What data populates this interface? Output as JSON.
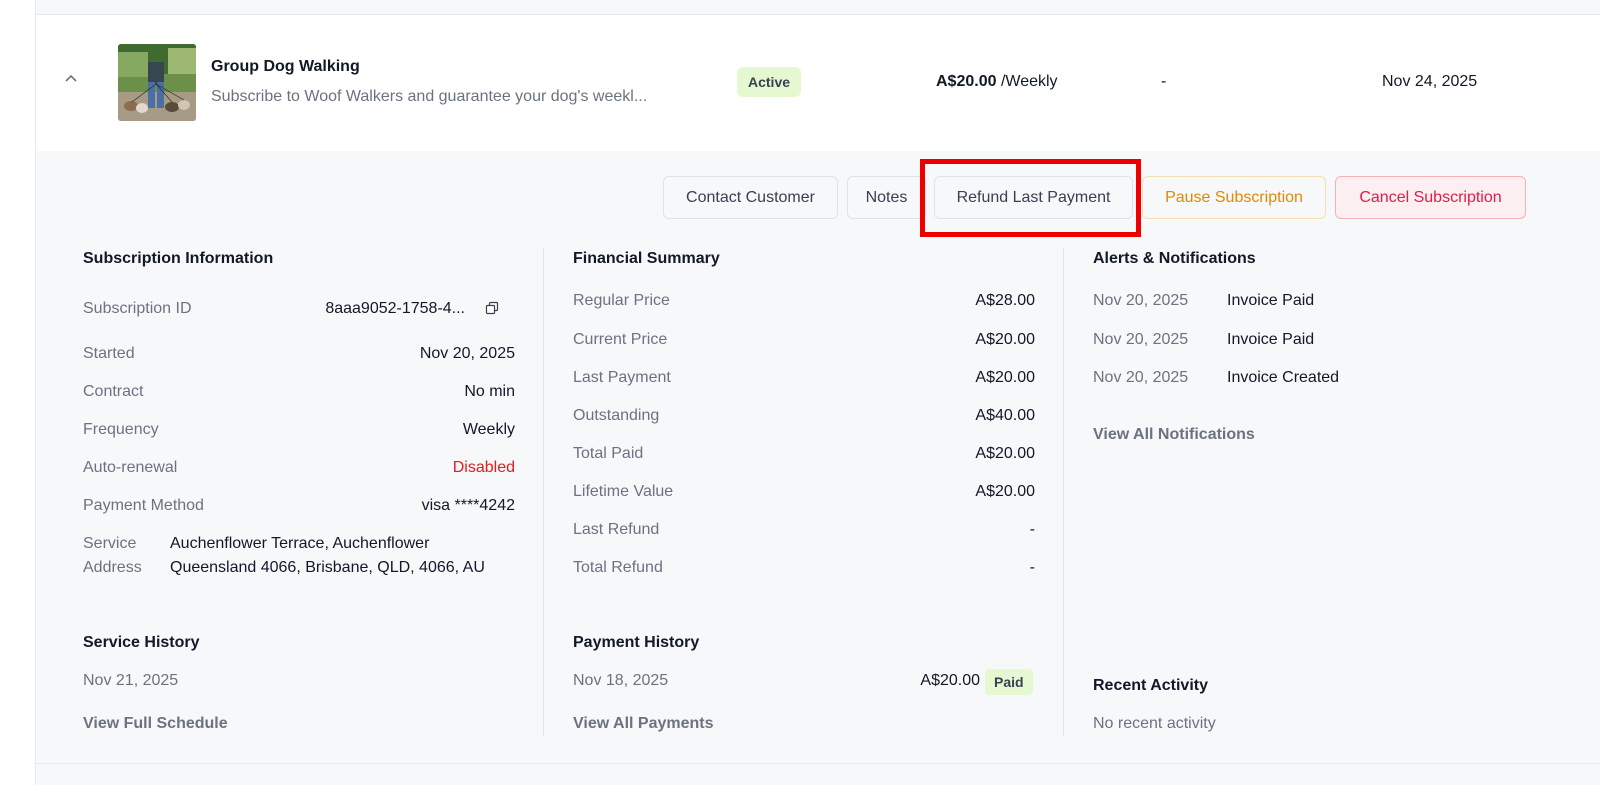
{
  "row": {
    "title": "Group Dog Walking",
    "description": "Subscribe to Woof Walkers and guarantee your dog's weekl...",
    "status": "Active",
    "price": "A$20.00",
    "price_period": " /Weekly",
    "dash": "-",
    "next_date": "Nov 24, 2025",
    "thumbnail_icon": "dog-walking-photo"
  },
  "actions": {
    "contact": "Contact Customer",
    "notes": "Notes",
    "refund": "Refund Last Payment",
    "pause": "Pause Subscription",
    "cancel": "Cancel Subscription"
  },
  "subscription_info": {
    "title": "Subscription Information",
    "id_label": "Subscription ID",
    "id_value": "8aaa9052-1758-4...",
    "started_label": "Started",
    "started_value": "Nov 20, 2025",
    "contract_label": "Contract",
    "contract_value": "No min",
    "frequency_label": "Frequency",
    "frequency_value": "Weekly",
    "autorenew_label": "Auto-renewal",
    "autorenew_value": "Disabled",
    "payment_label": "Payment Method",
    "payment_value": "visa ****4242",
    "address_label_1": "Service",
    "address_label_2": "Address",
    "address_value": "Auchenflower Terrace, Auchenflower Queensland 4066, Brisbane, QLD, 4066, AU"
  },
  "service_history": {
    "title": "Service History",
    "date": "Nov 21, 2025",
    "link": "View Full Schedule"
  },
  "financial": {
    "title": "Financial Summary",
    "rows": [
      {
        "label": "Regular Price",
        "value": "A$28.00"
      },
      {
        "label": "Current Price",
        "value": "A$20.00"
      },
      {
        "label": "Last Payment",
        "value": "A$20.00"
      },
      {
        "label": "Outstanding",
        "value": "A$40.00"
      },
      {
        "label": "Total Paid",
        "value": "A$20.00"
      },
      {
        "label": "Lifetime Value",
        "value": "A$20.00"
      },
      {
        "label": "Last Refund",
        "value": "-"
      },
      {
        "label": "Total Refund",
        "value": "-"
      }
    ]
  },
  "payment_history": {
    "title": "Payment History",
    "date": "Nov 18, 2025",
    "amount": "A$20.00",
    "status": "Paid",
    "link": "View All Payments"
  },
  "alerts": {
    "title": "Alerts & Notifications",
    "items": [
      {
        "date": "Nov 20, 2025",
        "text": "Invoice Paid"
      },
      {
        "date": "Nov 20, 2025",
        "text": "Invoice Paid"
      },
      {
        "date": "Nov 20, 2025",
        "text": "Invoice Created"
      }
    ],
    "link": "View All Notifications"
  },
  "recent_activity": {
    "title": "Recent Activity",
    "empty": "No recent activity"
  },
  "colors": {
    "accent_active": "#e6f8d2",
    "pause": "#e08a00",
    "cancel": "#e11d48",
    "disabled": "#e11d1d",
    "highlight": "#ee0000"
  }
}
